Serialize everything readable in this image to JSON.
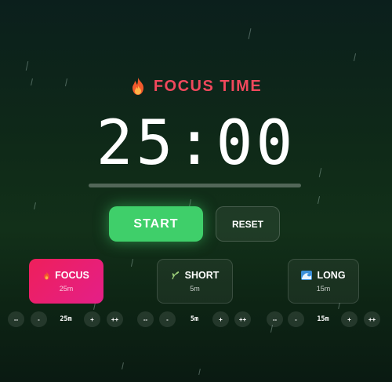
{
  "header": {
    "title": "FOCUS TIME",
    "icon": "flame-icon"
  },
  "timer": {
    "display": "25:00",
    "progress_fraction": 0.0
  },
  "controls": {
    "start_label": "START",
    "reset_label": "RESET"
  },
  "modes": [
    {
      "id": "focus",
      "label": "FOCUS",
      "duration": "25m",
      "icon": "flame-icon",
      "active": true
    },
    {
      "id": "short",
      "label": "SHORT",
      "duration": "5m",
      "icon": "leaf-icon",
      "active": false
    },
    {
      "id": "long",
      "label": "LONG",
      "duration": "15m",
      "icon": "wave-icon",
      "active": false
    }
  ],
  "adjusters": [
    {
      "dec_big": "--",
      "dec": "-",
      "value": "25m",
      "inc": "+",
      "inc_big": "++"
    },
    {
      "dec_big": "--",
      "dec": "-",
      "value": "5m",
      "inc": "+",
      "inc_big": "++"
    },
    {
      "dec_big": "--",
      "dec": "-",
      "value": "15m",
      "inc": "+",
      "inc_big": "++"
    }
  ],
  "colors": {
    "accent_title": "#f0485c",
    "start": "#3fcf6a",
    "focus_active": "#ee1f5b",
    "background": "#0f2a18"
  }
}
